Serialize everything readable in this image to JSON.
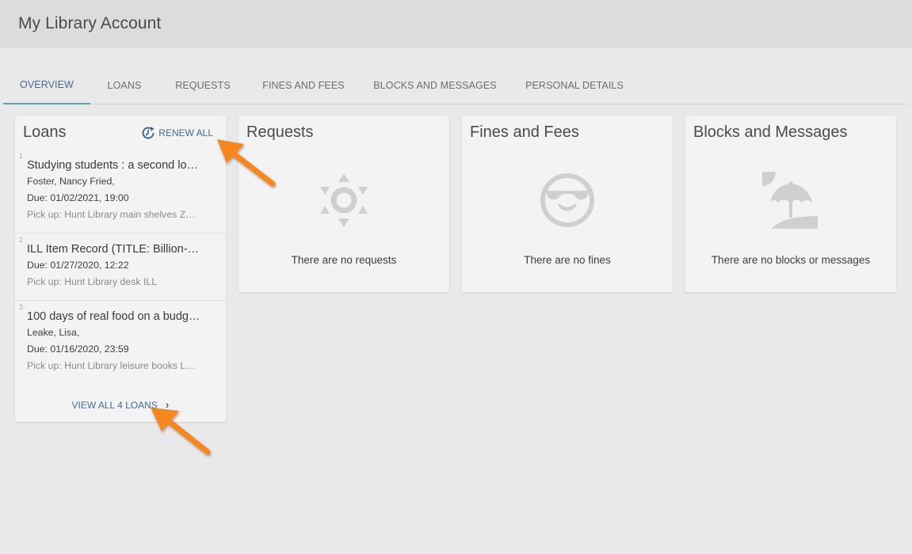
{
  "header": {
    "title": "My Library Account"
  },
  "tabs": [
    {
      "label": "OVERVIEW",
      "active": true
    },
    {
      "label": "LOANS",
      "active": false
    },
    {
      "label": "REQUESTS",
      "active": false
    },
    {
      "label": "FINES AND FEES",
      "active": false
    },
    {
      "label": "BLOCKS AND MESSAGES",
      "active": false
    },
    {
      "label": "PERSONAL DETAILS",
      "active": false
    }
  ],
  "loans": {
    "title": "Loans",
    "renew_all_label": "RENEW ALL",
    "renew_icon": "clock-renew-icon",
    "items": [
      {
        "num": "1",
        "title": "Studying students : a second lo…",
        "author": "Foster, Nancy Fried,",
        "due": "Due: 01/02/2021, 19:00",
        "pickup": "Pick up: Hunt Library main shelves Z…"
      },
      {
        "num": "2",
        "title": "ILL Item Record (TITLE: Billion-…",
        "due": "Due: 01/27/2020, 12:22",
        "pickup": "Pick up: Hunt Library desk ILL"
      },
      {
        "num": "3",
        "title": "100 days of real food on a budg…",
        "author": "Leake, Lisa,",
        "due": "Due: 01/16/2020, 23:59",
        "pickup": "Pick up: Hunt Library leisure books L…"
      }
    ],
    "view_all_label": "VIEW ALL 4 LOANS",
    "view_all_icon": "chevron-right-icon"
  },
  "requests": {
    "title": "Requests",
    "empty_text": "There are no requests",
    "icon": "sun-icon"
  },
  "fines": {
    "title": "Fines and Fees",
    "empty_text": "There are no fines",
    "icon": "sunglasses-smiley-icon"
  },
  "blocks": {
    "title": "Blocks and Messages",
    "empty_text": "There are no blocks or messages",
    "icon": "beach-umbrella-icon"
  },
  "colors": {
    "accent": "#3f6a8e",
    "tab_underline": "#5aa2b0",
    "annotation_arrow": "#f7861c",
    "empty_icon": "#cfcfcf"
  }
}
